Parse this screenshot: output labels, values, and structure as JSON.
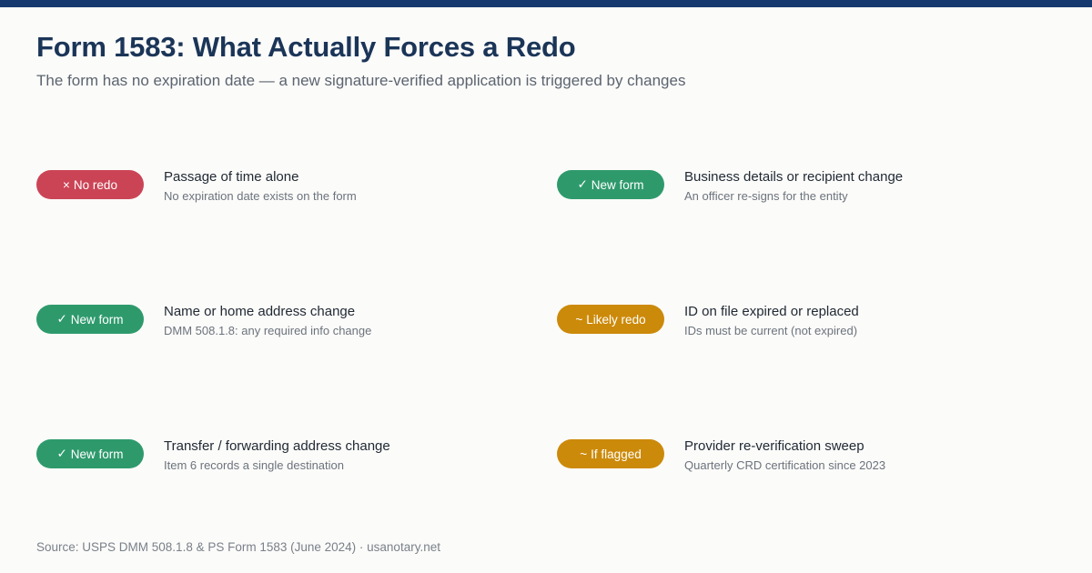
{
  "header": {
    "title": "Form 1583: What Actually Forces a Redo",
    "subtitle": "The form has no expiration date — a new signature-verified application is triggered by changes"
  },
  "colors": {
    "top_bar": "#163a70",
    "no_redo": "#cb4456",
    "new_form": "#2e9a6c",
    "likely": "#cc8a0a"
  },
  "items": [
    {
      "badge_glyph": "×",
      "badge_label": "No redo",
      "badge_color": "red",
      "title": "Passage of time alone",
      "description": "No expiration date exists on the form"
    },
    {
      "badge_glyph": "✓",
      "badge_label": "New form",
      "badge_color": "green",
      "title": "Business details or recipient change",
      "description": "An officer re-signs for the entity"
    },
    {
      "badge_glyph": "✓",
      "badge_label": "New form",
      "badge_color": "green",
      "title": "Name or home address change",
      "description": "DMM 508.1.8: any required info change"
    },
    {
      "badge_glyph": "~",
      "badge_label": "Likely redo",
      "badge_color": "amber",
      "title": "ID on file expired or replaced",
      "description": "IDs must be current (not expired)"
    },
    {
      "badge_glyph": "✓",
      "badge_label": "New form",
      "badge_color": "green",
      "title": "Transfer / forwarding address change",
      "description": "Item 6 records a single destination"
    },
    {
      "badge_glyph": "~",
      "badge_label": "If flagged",
      "badge_color": "amber",
      "title": "Provider re-verification sweep",
      "description": "Quarterly CRD certification since 2023"
    }
  ],
  "footer": {
    "source": "Source: USPS DMM 508.1.8 & PS Form 1583 (June 2024) · usanotary.net"
  }
}
